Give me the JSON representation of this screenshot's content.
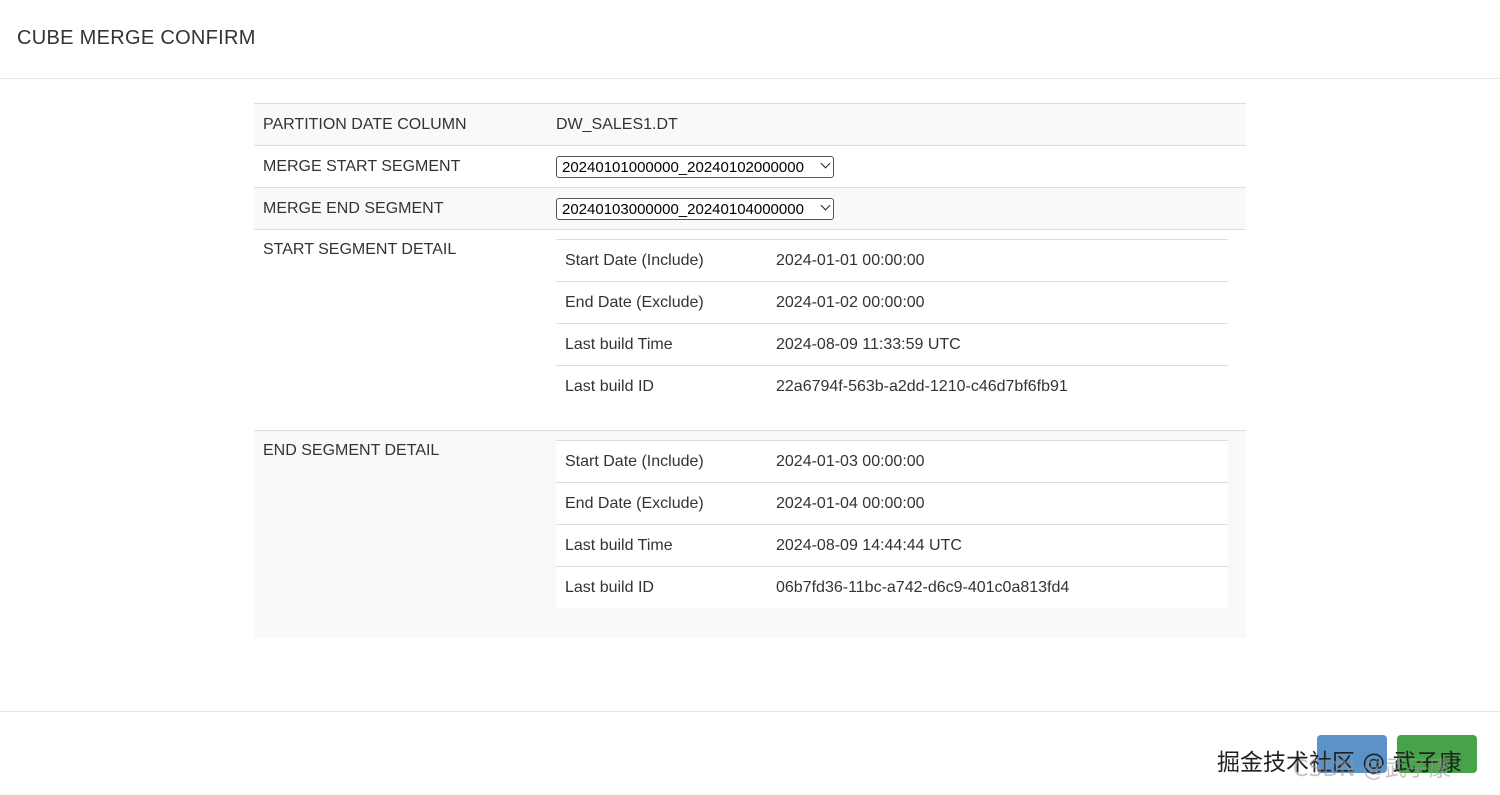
{
  "header": {
    "title": "CUBE MERGE CONFIRM"
  },
  "form": {
    "partition_date_column": {
      "label": "PARTITION DATE COLUMN",
      "value": "DW_SALES1.DT"
    },
    "merge_start_segment": {
      "label": "MERGE START SEGMENT",
      "selected": "20240101000000_20240102000000"
    },
    "merge_end_segment": {
      "label": "MERGE END SEGMENT",
      "selected": "20240103000000_20240104000000"
    },
    "start_segment_detail": {
      "label": "START SEGMENT DETAIL",
      "rows": [
        {
          "key": "Start Date (Include)",
          "value": "2024-01-01 00:00:00"
        },
        {
          "key": "End Date (Exclude)",
          "value": "2024-01-02 00:00:00"
        },
        {
          "key": "Last build Time",
          "value": "2024-08-09 11:33:59 UTC"
        },
        {
          "key": "Last build ID",
          "value": "22a6794f-563b-a2dd-1210-c46d7bf6fb91"
        }
      ]
    },
    "end_segment_detail": {
      "label": "END SEGMENT DETAIL",
      "rows": [
        {
          "key": "Start Date (Include)",
          "value": "2024-01-03 00:00:00"
        },
        {
          "key": "End Date (Exclude)",
          "value": "2024-01-04 00:00:00"
        },
        {
          "key": "Last build Time",
          "value": "2024-08-09 14:44:44 UTC"
        },
        {
          "key": "Last build ID",
          "value": "06b7fd36-11bc-a742-d6c9-401c0a813fd4"
        }
      ]
    }
  },
  "footer": {
    "watermark_text": "掘金技术社区 @ 武子康",
    "watermark_ghost": "CSDN @武子康"
  },
  "colors": {
    "close_button": "#5b93c9",
    "submit_button": "#46a349",
    "stripe": "#f9f9f9",
    "border": "#dddddd"
  }
}
